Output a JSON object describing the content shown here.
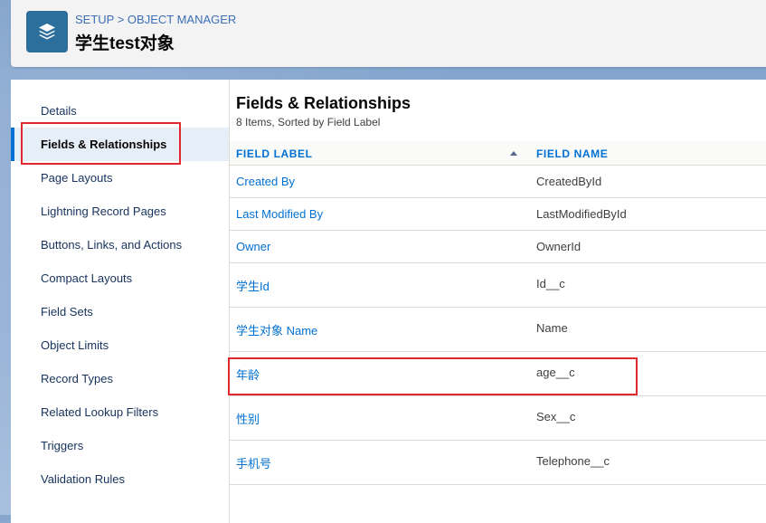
{
  "header": {
    "breadcrumb": "SETUP > OBJECT MANAGER",
    "title": "学生test对象",
    "icon": "layers-icon",
    "icon_color": "#2c6e9c"
  },
  "sidebar": {
    "items": [
      {
        "label": "Details",
        "active": false
      },
      {
        "label": "Fields & Relationships",
        "active": true
      },
      {
        "label": "Page Layouts",
        "active": false
      },
      {
        "label": "Lightning Record Pages",
        "active": false
      },
      {
        "label": "Buttons, Links, and Actions",
        "active": false
      },
      {
        "label": "Compact Layouts",
        "active": false
      },
      {
        "label": "Field Sets",
        "active": false
      },
      {
        "label": "Object Limits",
        "active": false
      },
      {
        "label": "Record Types",
        "active": false
      },
      {
        "label": "Related Lookup Filters",
        "active": false
      },
      {
        "label": "Triggers",
        "active": false
      },
      {
        "label": "Validation Rules",
        "active": false
      }
    ]
  },
  "main": {
    "title": "Fields & Relationships",
    "subtitle": "8 Items, Sorted by Field Label",
    "columns": {
      "field_label": "FIELD LABEL",
      "field_name": "FIELD NAME",
      "sort": "ascending"
    },
    "rows": [
      {
        "label": "Created By",
        "name": "CreatedById"
      },
      {
        "label": "Last Modified By",
        "name": "LastModifiedById"
      },
      {
        "label": "Owner",
        "name": "OwnerId"
      },
      {
        "label": "学生Id",
        "name": "Id__c"
      },
      {
        "label": "学生对象 Name",
        "name": "Name"
      },
      {
        "label": "年龄",
        "name": "age__c"
      },
      {
        "label": "性别",
        "name": "Sex__c"
      },
      {
        "label": "手机号",
        "name": "Telephone__c"
      }
    ]
  },
  "colors": {
    "link": "#0070d2",
    "active_bar": "#0070d2",
    "annotation": "#e0282e"
  }
}
